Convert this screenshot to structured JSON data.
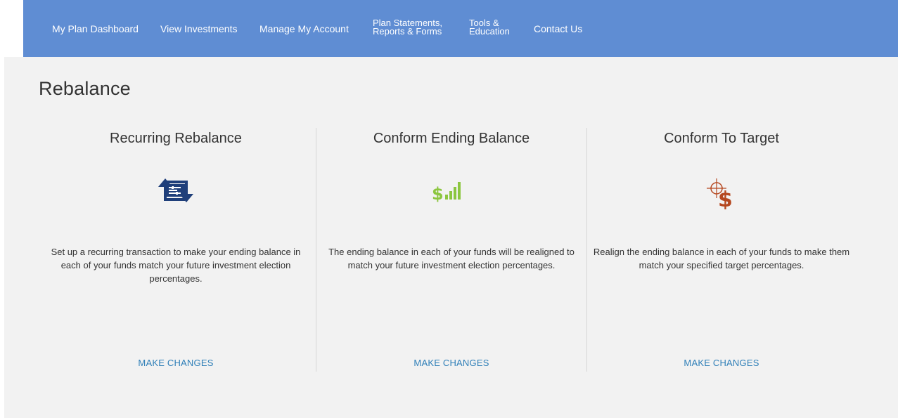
{
  "nav": {
    "items": [
      {
        "label": "My Plan Dashboard"
      },
      {
        "label": "View Investments"
      },
      {
        "label": "Manage My Account"
      },
      {
        "line1": "Plan Statements,",
        "line2": "Reports & Forms"
      },
      {
        "line1": "Tools &",
        "line2": "Education"
      },
      {
        "label": "Contact Us"
      }
    ]
  },
  "page": {
    "title": "Rebalance"
  },
  "cards": [
    {
      "title": "Recurring Rebalance",
      "icon": "recurring-rebalance-icon",
      "description": "Set up a recurring transaction to make your ending balance in each of your funds match your future investment election percentages.",
      "action": "MAKE CHANGES"
    },
    {
      "title": "Conform Ending Balance",
      "icon": "dollar-bars-icon",
      "description": "The ending balance in each of your funds will be realigned to match your future investment election percentages.",
      "action": "MAKE CHANGES"
    },
    {
      "title": "Conform To Target",
      "icon": "crosshair-dollar-icon",
      "description": "Realign the ending balance in each of your funds to make them match your specified target percentages.",
      "action": "MAKE CHANGES"
    }
  ],
  "colors": {
    "nav_bg": "#5f8dd3",
    "link": "#2f7fb8",
    "icon_navy": "#1f3f7a",
    "icon_green": "#8cc63f",
    "icon_orange": "#b5471f"
  }
}
